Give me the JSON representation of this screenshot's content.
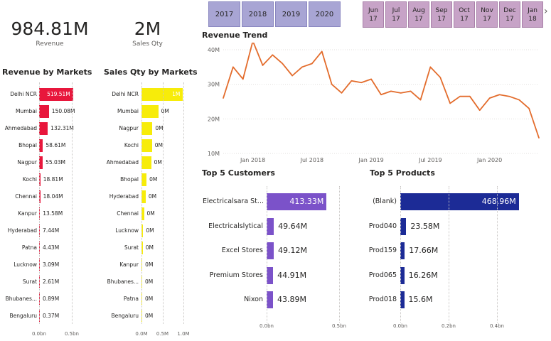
{
  "kpis": {
    "revenue": {
      "value": "984.81M",
      "label": "Revenue"
    },
    "sales_qty": {
      "value": "2M",
      "label": "Sales Qty"
    }
  },
  "slicers": {
    "years": [
      "2017",
      "2018",
      "2019",
      "2020"
    ],
    "months": [
      {
        "m": "Jun",
        "y": "17"
      },
      {
        "m": "Jul",
        "y": "17"
      },
      {
        "m": "Aug",
        "y": "17"
      },
      {
        "m": "Sep",
        "y": "17"
      },
      {
        "m": "Oct",
        "y": "17"
      },
      {
        "m": "Nov",
        "y": "17"
      },
      {
        "m": "Dec",
        "y": "17"
      },
      {
        "m": "Jan",
        "y": "18"
      }
    ],
    "next_arrow": "›"
  },
  "colors": {
    "revenue_bar": "#e8173c",
    "qty_bar": "#f7ec0a",
    "trend_line": "#e36c2c",
    "customers_bar": "#7b52c9",
    "products_bar": "#1c2b96"
  },
  "chart_data": [
    {
      "id": "revenue_by_markets",
      "type": "bar",
      "title": "Revenue by Markets",
      "orientation": "horizontal",
      "categories": [
        "Delhi NCR",
        "Mumbai",
        "Ahmedabad",
        "Bhopal",
        "Nagpur",
        "Kochi",
        "Chennai",
        "Kanpur",
        "Hyderabad",
        "Patna",
        "Lucknow",
        "Surat",
        "Bhubanes...",
        "Bengaluru"
      ],
      "values": [
        519.51,
        150.08,
        132.31,
        58.61,
        55.03,
        18.81,
        18.04,
        13.58,
        7.44,
        4.43,
        3.09,
        2.61,
        0.89,
        0.37
      ],
      "value_labels": [
        "519.51M",
        "150.08M",
        "132.31M",
        "58.61M",
        "55.03M",
        "18.81M",
        "18.04M",
        "13.58M",
        "7.44M",
        "4.43M",
        "3.09M",
        "2.61M",
        "0.89M",
        "0.37M"
      ],
      "xlim": [
        0,
        500
      ],
      "x_ticks": [
        "0.0bn",
        "0.5bn"
      ]
    },
    {
      "id": "sales_qty_by_markets",
      "type": "bar",
      "title": "Sales Qty by Markets",
      "orientation": "horizontal",
      "categories": [
        "Delhi NCR",
        "Mumbai",
        "Nagpur",
        "Kochi",
        "Ahmedabad",
        "Bhopal",
        "Hyderabad",
        "Chennai",
        "Lucknow",
        "Surat",
        "Kanpur",
        "Bhubanes...",
        "Patna",
        "Bengaluru"
      ],
      "values": [
        0.99,
        0.4,
        0.26,
        0.25,
        0.23,
        0.12,
        0.1,
        0.06,
        0.04,
        0.03,
        0.02,
        0.01,
        0.005,
        0.003
      ],
      "value_labels": [
        "1M",
        "0M",
        "0M",
        "0M",
        "0M",
        "0M",
        "0M",
        "0M",
        "0M",
        "0M",
        "0M",
        "0M",
        "0M",
        "0M"
      ],
      "xlim": [
        0,
        1.0
      ],
      "x_ticks": [
        "0.0M",
        "0.5M",
        "1.0M"
      ]
    },
    {
      "id": "revenue_trend",
      "type": "line",
      "title": "Revenue Trend",
      "x": [
        "2017-10",
        "2017-11",
        "2017-12",
        "2018-01",
        "2018-02",
        "2018-03",
        "2018-04",
        "2018-05",
        "2018-06",
        "2018-07",
        "2018-08",
        "2018-09",
        "2018-10",
        "2018-11",
        "2018-12",
        "2019-01",
        "2019-02",
        "2019-03",
        "2019-04",
        "2019-05",
        "2019-06",
        "2019-07",
        "2019-08",
        "2019-09",
        "2019-10",
        "2019-11",
        "2019-12",
        "2020-01",
        "2020-02",
        "2020-03",
        "2020-04",
        "2020-05",
        "2020-06"
      ],
      "values": [
        26,
        35,
        31.5,
        42.5,
        35.5,
        38.5,
        36,
        32.5,
        35,
        36,
        39.5,
        30,
        27.5,
        31,
        30.5,
        31.5,
        27,
        28,
        27.5,
        28,
        25.5,
        35,
        32,
        24.5,
        26.5,
        26.5,
        22.5,
        26,
        27,
        26.5,
        25.5,
        23,
        14.5
      ],
      "x_ticks": [
        "Jan 2018",
        "Jul 2018",
        "Jan 2019",
        "Jul 2019",
        "Jan 2020"
      ],
      "y_ticks": [
        "40M",
        "30M",
        "20M",
        "10M"
      ],
      "ylim": [
        10,
        40
      ]
    },
    {
      "id": "top5_customers",
      "type": "bar",
      "title": "Top 5 Customers",
      "orientation": "horizontal",
      "categories": [
        "Electricalsara St...",
        "Electricalslytical",
        "Excel Stores",
        "Premium Stores",
        "Nixon"
      ],
      "values": [
        413.33,
        49.64,
        49.12,
        44.91,
        43.89
      ],
      "value_labels": [
        "413.33M",
        "49.64M",
        "49.12M",
        "44.91M",
        "43.89M"
      ],
      "xlim": [
        0,
        500
      ],
      "x_ticks": [
        "0.0bn",
        "0.5bn"
      ]
    },
    {
      "id": "top5_products",
      "type": "bar",
      "title": "Top 5 Products",
      "orientation": "horizontal",
      "categories": [
        "(Blank)",
        "Prod040",
        "Prod159",
        "Prod065",
        "Prod018"
      ],
      "values": [
        468.96,
        23.58,
        17.66,
        16.26,
        15.6
      ],
      "value_labels": [
        "468.96M",
        "23.58M",
        "17.66M",
        "16.26M",
        "15.6M"
      ],
      "xlim": [
        0,
        450
      ],
      "x_ticks": [
        "0.0bn",
        "0.2bn",
        "0.4bn"
      ]
    }
  ]
}
